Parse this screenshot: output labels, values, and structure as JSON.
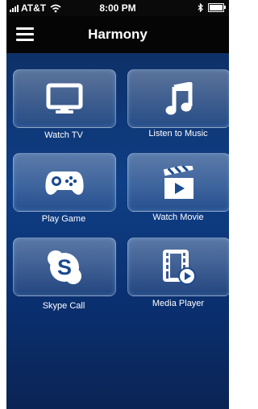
{
  "status_bar": {
    "carrier": "AT&T",
    "time": "8:00 PM",
    "icons": [
      "signal-icon",
      "wifi-icon",
      "bluetooth-icon",
      "battery-icon"
    ]
  },
  "nav": {
    "title": "Harmony",
    "menu_icon": "hamburger-icon"
  },
  "activities": [
    {
      "label": "Watch TV",
      "icon": "tv-icon"
    },
    {
      "label": "Listen to Music",
      "icon": "music-note-icon"
    },
    {
      "label": "Play Game",
      "icon": "gamepad-icon"
    },
    {
      "label": "Watch Movie",
      "icon": "clapperboard-icon"
    },
    {
      "label": "Skype Call",
      "icon": "skype-icon"
    },
    {
      "label": "Media Player",
      "icon": "film-play-icon"
    }
  ],
  "colors": {
    "background_top": "#0d2a5c",
    "background_mid": "#0f3f86",
    "header": "#050505",
    "text": "#ffffff"
  }
}
